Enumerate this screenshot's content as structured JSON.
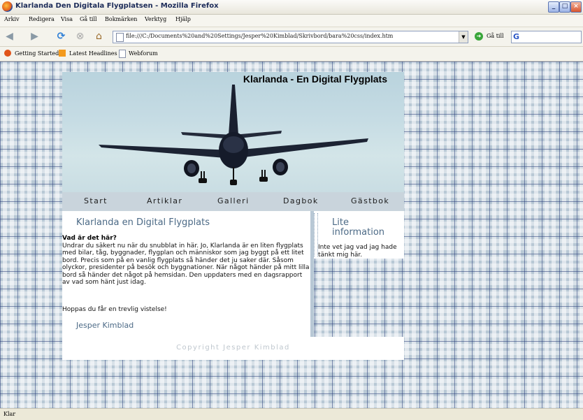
{
  "window": {
    "title": "Klarlanda Den Digitala Flygplatsen - Mozilla Firefox",
    "controls": [
      "_",
      "□",
      "×"
    ]
  },
  "menu": {
    "items": [
      "Arkiv",
      "Redigera",
      "Visa",
      "Gå till",
      "Bokmärken",
      "Verktyg",
      "Hjälp"
    ]
  },
  "toolbar": {
    "url": "file:///C:/Documents%20and%20Settings/Jesper%20Kimblad/Skrivbord/bara%20css/index.htm",
    "go_label": "Gå till",
    "search_value": ""
  },
  "bookmarks": {
    "items": [
      "Getting Started",
      "Latest Headlines",
      "Webforum"
    ]
  },
  "page": {
    "site_title": "Klarlanda - En Digital Flygplats",
    "nav": [
      "Start",
      "Artiklar",
      "Galleri",
      "Dagbok",
      "Gästbok"
    ],
    "main": {
      "heading": "Klarlanda en Digital Flygplats",
      "question": "Vad är det här?",
      "body": "Undrar du säkert nu när du snubblat in här. Jo, Klarlanda är en liten flygplats med bilar, tåg, byggnader, flygplan och människor som jag byggt på ett litet bord. Precis som på en vanlig flygplats så händer det ju saker där. Såsom olyckor, presidenter på besök och byggnationer. När något händer på mitt lilla bord så händer det något på hemsidan. Den uppdaters med en dagsrapport av vad som hänt just idag.",
      "closing": "Hoppas du får en trevlig vistelse!",
      "signature": "Jesper Kimblad"
    },
    "side": {
      "heading": "Lite information",
      "text": "Inte vet jag vad jag hade tänkt mig här."
    },
    "footer": "Copyright Jesper Kimblad"
  },
  "status": {
    "text": "Klar"
  },
  "colors": {
    "accent": "#4c6a86",
    "nav_bg": "#c9d4dc",
    "plaid": "#b8c8d5"
  }
}
